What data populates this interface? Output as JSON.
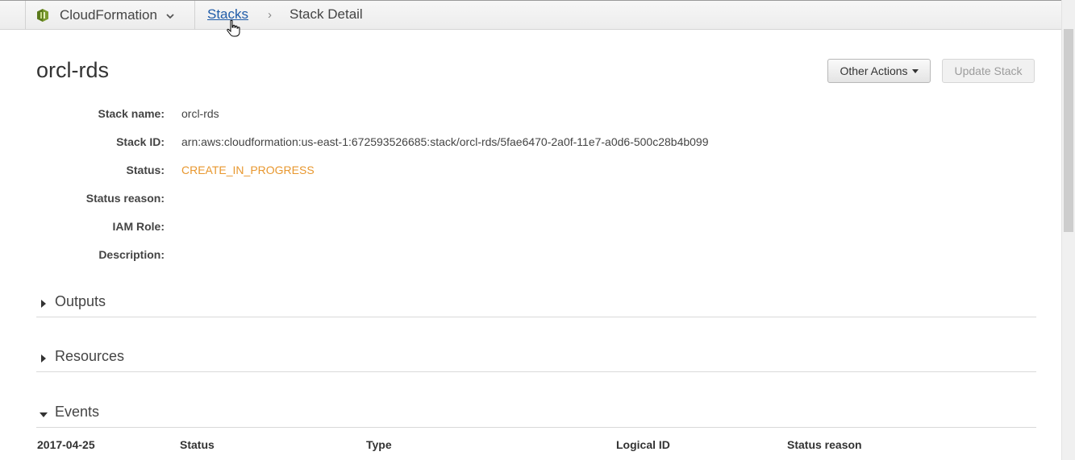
{
  "nav": {
    "service": "CloudFormation",
    "breadcrumb_link": "Stacks",
    "breadcrumb_separator": "›",
    "breadcrumb_current": "Stack Detail"
  },
  "header": {
    "title": "orcl-rds",
    "other_actions_label": "Other Actions",
    "update_stack_label": "Update Stack"
  },
  "details": [
    {
      "label": "Stack name:",
      "value": "orcl-rds"
    },
    {
      "label": "Stack ID:",
      "value": "arn:aws:cloudformation:us-east-1:672593526685:stack/orcl-rds/5fae6470-2a0f-11e7-a0d6-500c28b4b099"
    },
    {
      "label": "Status:",
      "value": "CREATE_IN_PROGRESS"
    },
    {
      "label": "Status reason:",
      "value": ""
    },
    {
      "label": "IAM Role:",
      "value": ""
    },
    {
      "label": "Description:",
      "value": ""
    }
  ],
  "sections": [
    {
      "label": "Outputs",
      "expanded": false
    },
    {
      "label": "Resources",
      "expanded": false
    },
    {
      "label": "Events",
      "expanded": true
    }
  ],
  "events_table": {
    "columns": [
      "2017-04-25",
      "Status",
      "Type",
      "Logical ID",
      "Status reason"
    ]
  },
  "colors": {
    "status_in_progress": "#e8972e",
    "link": "#1f5ba8",
    "service_icon": "#6b8e23"
  },
  "icons": {
    "service": "cloudformation-icon",
    "menu_chevron": "chevron-down-icon",
    "cursor": "hand-pointer-icon"
  }
}
